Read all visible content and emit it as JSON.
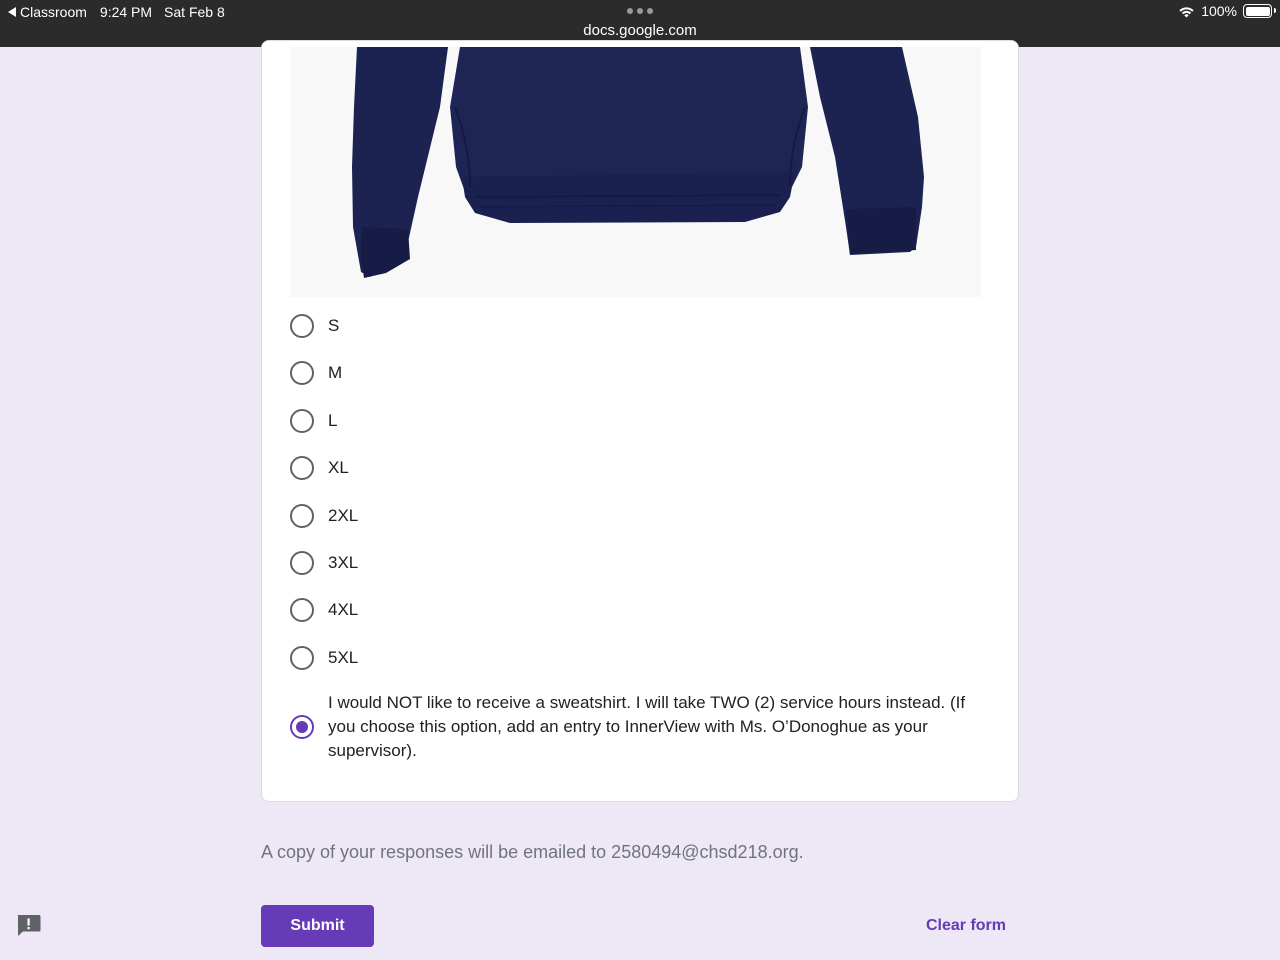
{
  "status_bar": {
    "back_app": "Classroom",
    "time": "9:24 PM",
    "date": "Sat Feb 8",
    "battery": "100%",
    "url": "docs.google.com"
  },
  "question": {
    "image": "sweatshirt-image",
    "options": [
      {
        "label": "S",
        "selected": false
      },
      {
        "label": "M",
        "selected": false
      },
      {
        "label": "L",
        "selected": false
      },
      {
        "label": "XL",
        "selected": false
      },
      {
        "label": "2XL",
        "selected": false
      },
      {
        "label": "3XL",
        "selected": false
      },
      {
        "label": "4XL",
        "selected": false
      },
      {
        "label": "5XL",
        "selected": false
      },
      {
        "label": "I would NOT like to receive a sweatshirt. I will take TWO (2) service hours instead. (If you choose this option, add an entry to InnerView with Ms. O’Donoghue as your supervisor).",
        "selected": true
      }
    ]
  },
  "footer": {
    "email_note": "A copy of your responses will be emailed to 2580494@chsd218.org.",
    "submit_label": "Submit",
    "clear_label": "Clear form"
  },
  "colors": {
    "accent": "#673ab7",
    "background": "#ede7f6"
  }
}
